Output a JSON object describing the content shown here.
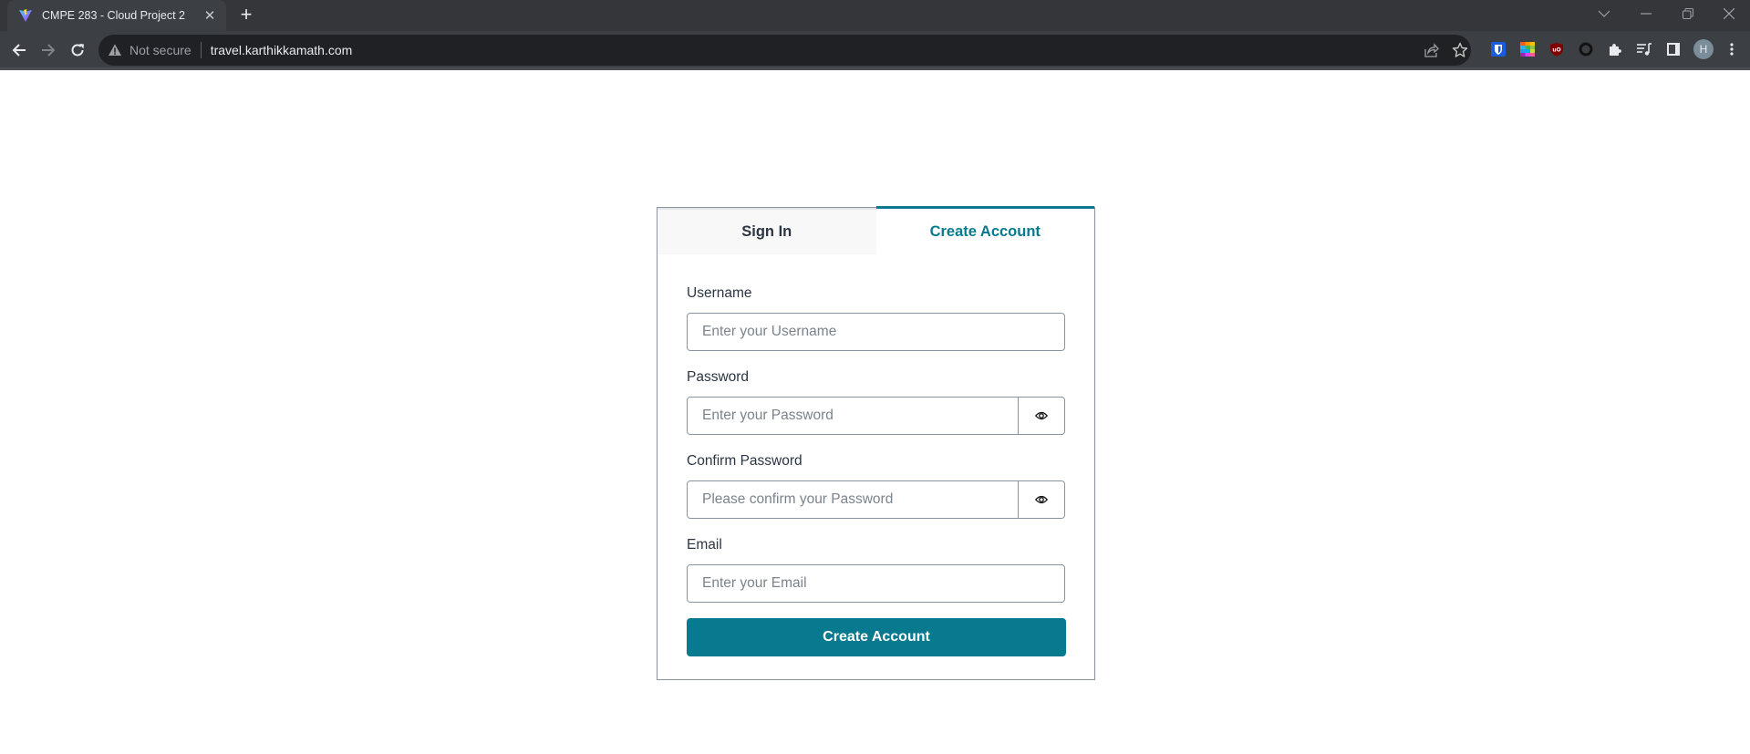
{
  "browser": {
    "tab": {
      "title": "CMPE 283 - Cloud Project 2",
      "favicon": "vite-logo-icon"
    },
    "new_tab_label": "+",
    "address_bar": {
      "security_label": "Not secure",
      "url": "travel.karthikkamath.com"
    },
    "profile_initial": "H",
    "extensions": [
      "bitwarden-icon",
      "color-palette-icon",
      "ublock-origin-icon",
      "dark-reader-icon",
      "extensions-puzzle-icon",
      "media-queue-icon",
      "side-panel-icon"
    ],
    "window_controls": [
      "tab-search",
      "minimize",
      "restore",
      "close"
    ]
  },
  "auth": {
    "tabs": [
      {
        "label": "Sign In",
        "active": false
      },
      {
        "label": "Create Account",
        "active": true
      }
    ],
    "fields": {
      "username": {
        "label": "Username",
        "placeholder": "Enter your Username",
        "value": ""
      },
      "password": {
        "label": "Password",
        "placeholder": "Enter your Password",
        "value": ""
      },
      "confirm_password": {
        "label": "Confirm Password",
        "placeholder": "Please confirm your Password",
        "value": ""
      },
      "email": {
        "label": "Email",
        "placeholder": "Enter your Email",
        "value": ""
      }
    },
    "submit_label": "Create Account",
    "accent_color": "#087a8f"
  }
}
